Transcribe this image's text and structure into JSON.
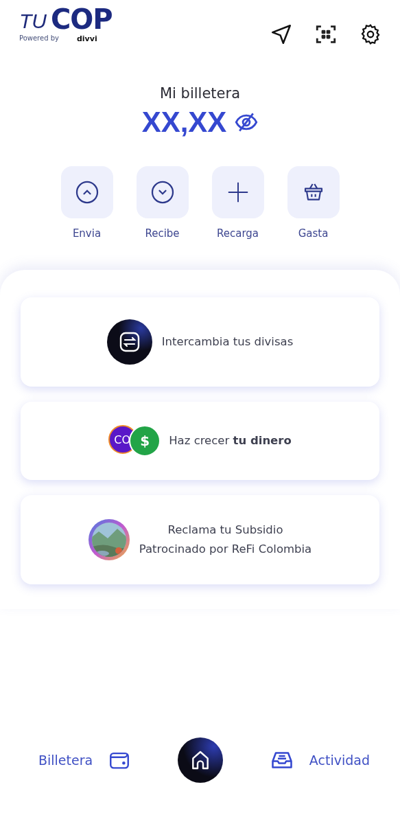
{
  "logo": {
    "prefix": "TU",
    "brand": "COP",
    "powered": "Powered by",
    "partner": "divvi"
  },
  "balance": {
    "label": "Mi billetera",
    "amount": "XX,XX",
    "hidden": true
  },
  "actions": [
    {
      "kind": "send",
      "label": "Envia"
    },
    {
      "kind": "receive",
      "label": "Recibe"
    },
    {
      "kind": "topup",
      "label": "Recarga"
    },
    {
      "kind": "spend",
      "label": "Gasta"
    }
  ],
  "cards": [
    {
      "kind": "exchange",
      "lines": [
        "Intercambia tus divisas"
      ]
    },
    {
      "kind": "coins",
      "coin_text": "CO",
      "coin_symbol": "$",
      "lines": [
        "Haz crecer **tu dinero**"
      ]
    },
    {
      "kind": "picture",
      "lines": [
        "Reclama tu Subsidio",
        "Patrocinado por ReFi Colombia"
      ]
    }
  ],
  "nav": [
    {
      "kind": "wallet",
      "label": "Billetera"
    },
    {
      "kind": "home"
    },
    {
      "kind": "activity",
      "label": "Actividad"
    }
  ]
}
